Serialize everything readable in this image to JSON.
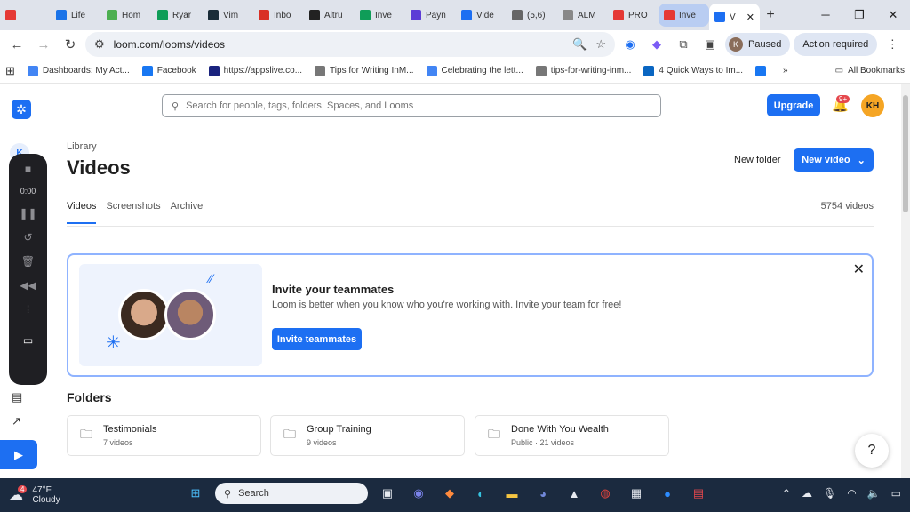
{
  "browser": {
    "tabs": [
      {
        "label": "",
        "color": "#e53935"
      },
      {
        "label": "Life",
        "color": "#1a73e8"
      },
      {
        "label": "Hom",
        "color": "#4caf50"
      },
      {
        "label": "Ryar",
        "color": "#0f9d58"
      },
      {
        "label": "Vim",
        "color": "#1a2c38"
      },
      {
        "label": "Inbo",
        "color": "#d93025"
      },
      {
        "label": "Altru",
        "color": "#222222"
      },
      {
        "label": "Inve",
        "color": "#0f9d58"
      },
      {
        "label": "Payn",
        "color": "#5c3cd6"
      },
      {
        "label": "Vide",
        "color": "#1d6ff2"
      },
      {
        "label": "(5,6)",
        "color": "#666666"
      },
      {
        "label": "ALM",
        "color": "#888888"
      },
      {
        "label": "PRO",
        "color": "#e53935"
      },
      {
        "label": "Inve",
        "color": "#e53935"
      },
      {
        "label": "V",
        "color": "#1d6ff2"
      }
    ],
    "new_tab": "+",
    "url": "loom.com/looms/videos",
    "profile_initial": "K",
    "paused_label": "Paused",
    "action_label": "Action required",
    "bookmarks": [
      {
        "label": "Dashboards: My Act...",
        "color": "#4285f4"
      },
      {
        "label": "Facebook",
        "color": "#1877f2"
      },
      {
        "label": "https://appslive.co...",
        "color": "#1a237e"
      },
      {
        "label": "Tips for Writing InM...",
        "color": "#777777"
      },
      {
        "label": "Celebrating the lett...",
        "color": "#4285f4"
      },
      {
        "label": "tips-for-writing-inm...",
        "color": "#777777"
      },
      {
        "label": "4 Quick Ways to Im...",
        "color": "#0a66c2"
      },
      {
        "label": "",
        "color": "#1877f2"
      }
    ],
    "bookmarks_more": "»",
    "all_bookmarks": "All Bookmarks"
  },
  "app": {
    "rail_initial": "K",
    "recorder_time": "0:00",
    "search_placeholder": "Search for people, tags, folders, Spaces, and Looms",
    "upgrade_label": "Upgrade",
    "notif_badge": "9+",
    "avatar_initials": "KH",
    "breadcrumb": "Library",
    "title": "Videos",
    "new_folder_label": "New folder",
    "new_video_label": "New video",
    "tabs": [
      "Videos",
      "Screenshots",
      "Archive"
    ],
    "video_count": "5754 videos",
    "invite": {
      "heading": "Invite your teammates",
      "body": "Loom is better when you know who you're working with. Invite your team for free!",
      "button": "Invite teammates"
    },
    "folders_heading": "Folders",
    "folders": [
      {
        "name": "Testimonials",
        "meta": "7 videos"
      },
      {
        "name": "Group Training",
        "meta": "9 videos"
      },
      {
        "name": "Done With You Wealth",
        "meta": "Public · 21 videos"
      }
    ],
    "help": "?",
    "accent": "#1d6ff2"
  },
  "taskbar": {
    "weather_badge": "4",
    "temperature": "47°F",
    "condition": "Cloudy",
    "search_label": "Search"
  }
}
